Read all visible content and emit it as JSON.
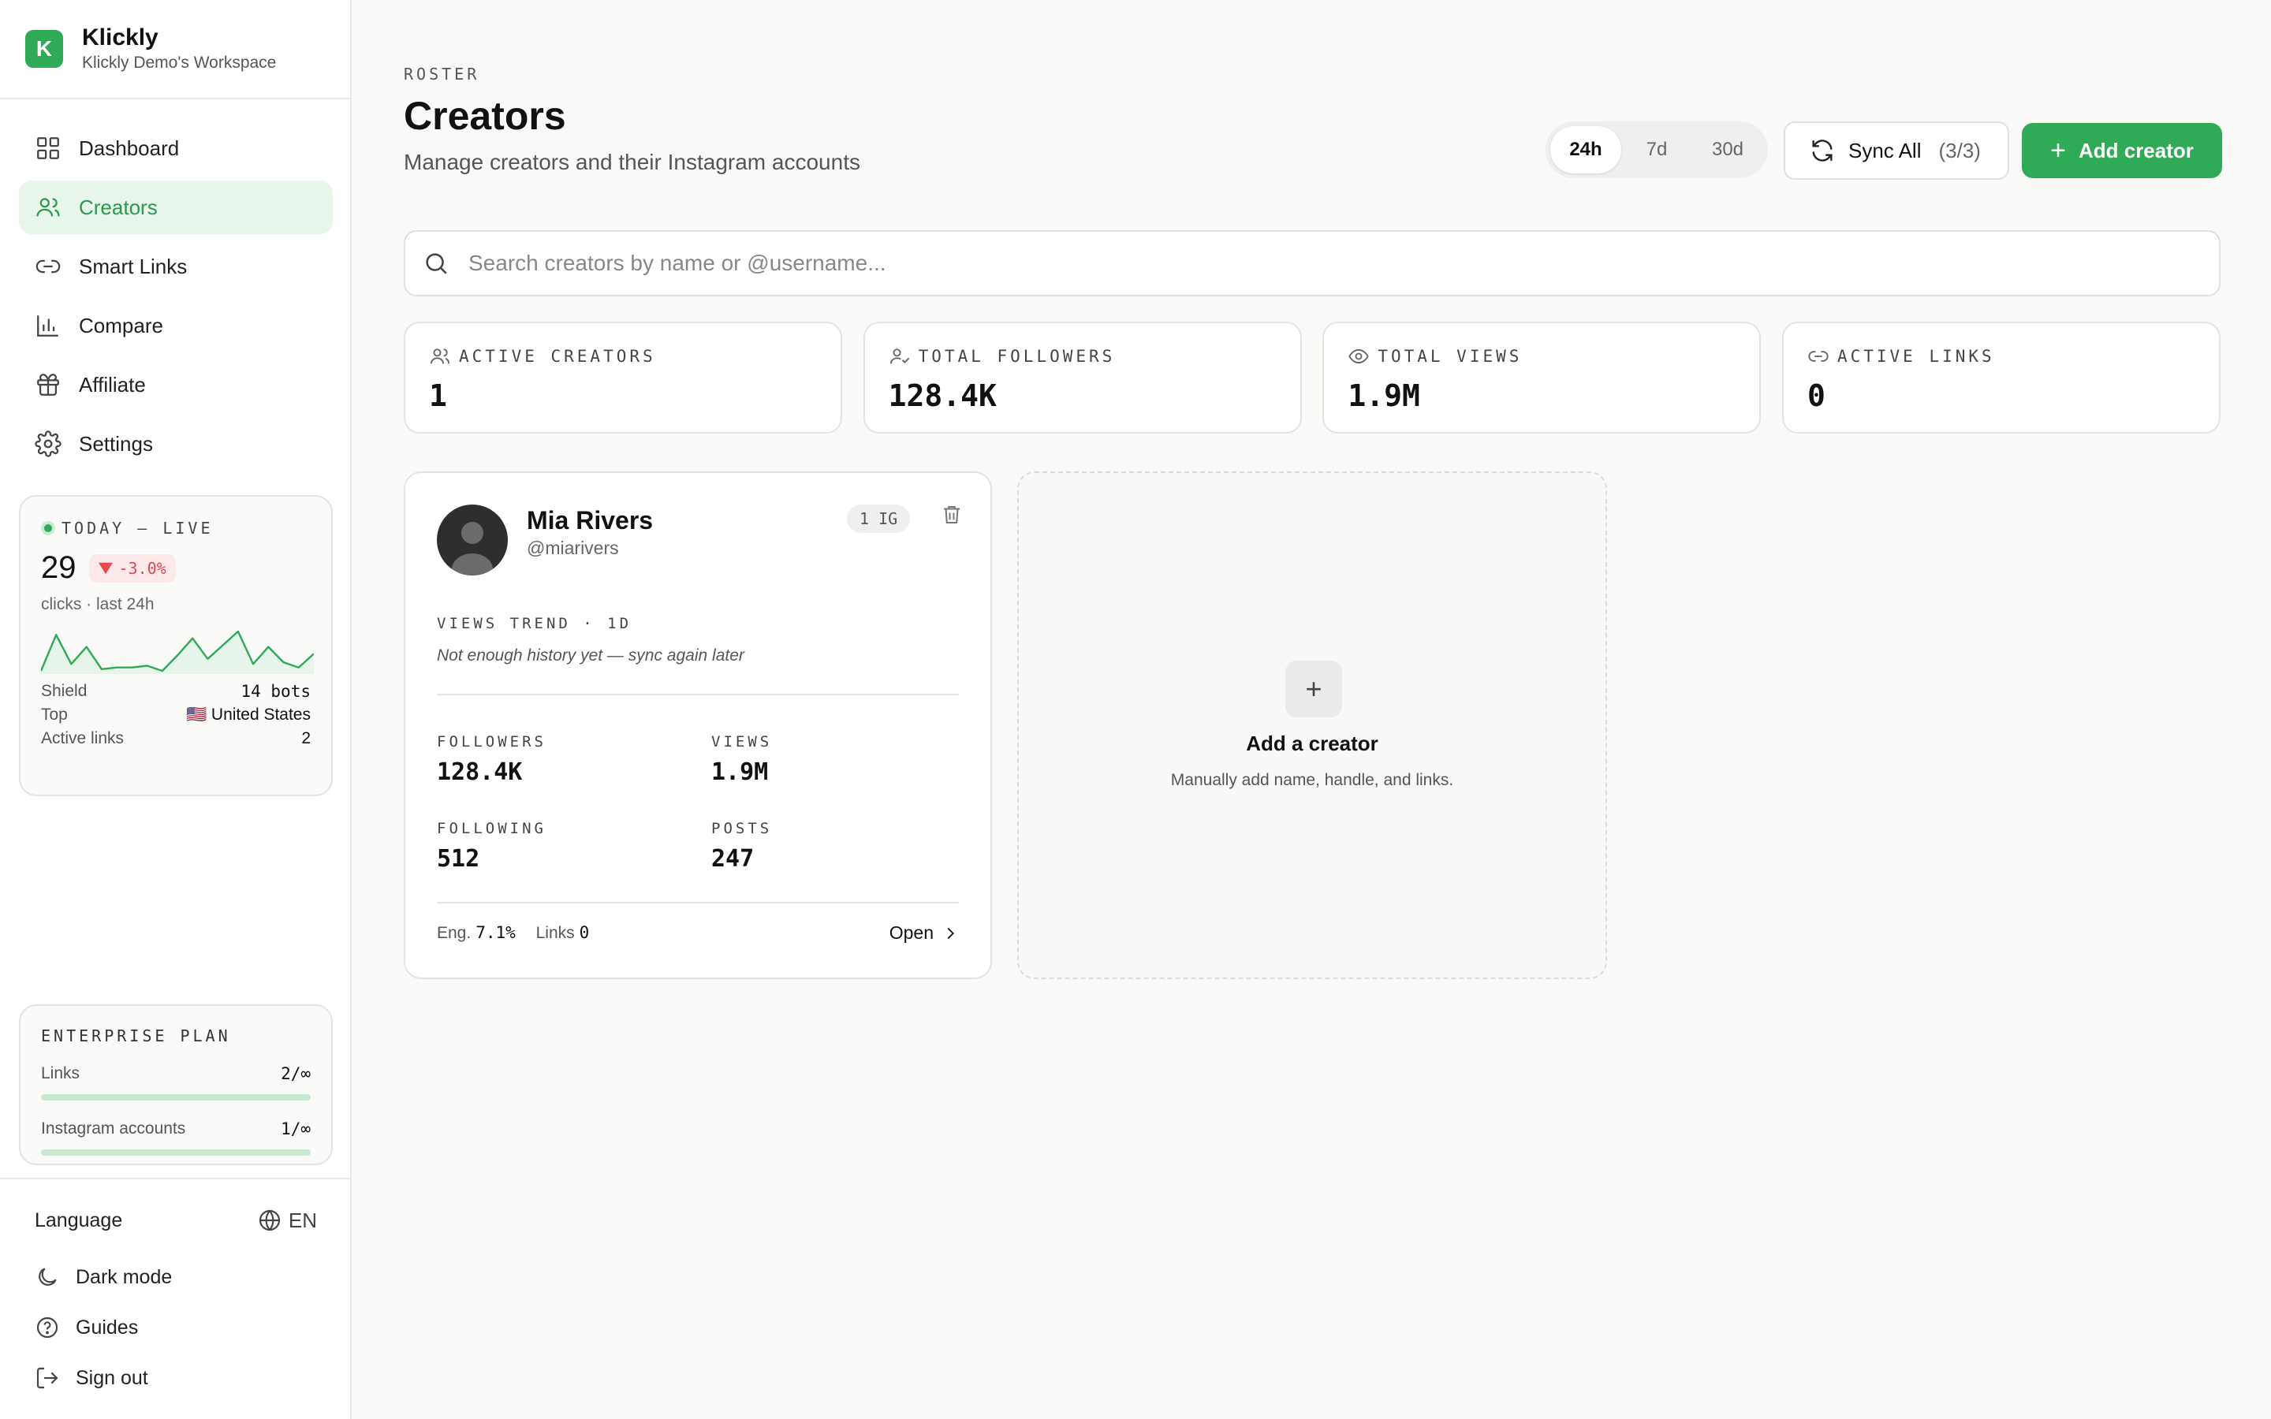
{
  "brand": {
    "logo_letter": "K",
    "name": "Klickly",
    "workspace": "Klickly Demo's Workspace"
  },
  "nav": [
    {
      "label": "Dashboard",
      "icon": "dashboard-icon",
      "active": false
    },
    {
      "label": "Creators",
      "icon": "users-icon",
      "active": true
    },
    {
      "label": "Smart Links",
      "icon": "link-icon",
      "active": false
    },
    {
      "label": "Compare",
      "icon": "bar-chart-icon",
      "active": false
    },
    {
      "label": "Affiliate",
      "icon": "gift-icon",
      "active": false
    },
    {
      "label": "Settings",
      "icon": "gear-icon",
      "active": false
    }
  ],
  "live": {
    "title": "TODAY — LIVE",
    "clicks": "29",
    "change": "-3.0%",
    "sub": "clicks · last 24h",
    "sparkline": [
      0,
      42,
      8,
      28,
      2,
      4,
      4,
      6,
      0,
      18,
      38,
      14,
      30,
      46,
      8,
      28,
      10,
      4,
      20
    ],
    "shield_label": "Shield",
    "shield_value": "14 bots",
    "top_label": "Top",
    "top_value": "🇺🇸 United States",
    "links_label": "Active links",
    "links_value": "2"
  },
  "plan": {
    "title": "ENTERPRISE PLAN",
    "links_label": "Links",
    "links_value": "2/∞",
    "ig_label": "Instagram accounts",
    "ig_value": "1/∞"
  },
  "bottom": {
    "language_label": "Language",
    "language_value": "EN",
    "dark_mode": "Dark mode",
    "guides": "Guides",
    "sign_out": "Sign out"
  },
  "header": {
    "eyebrow": "ROSTER",
    "title": "Creators",
    "subtitle": "Manage creators and their Instagram accounts",
    "ranges": [
      "24h",
      "7d",
      "30d"
    ],
    "active_range": "24h",
    "sync_label": "Sync All",
    "sync_count": "(3/3)",
    "add_label": "Add creator"
  },
  "search": {
    "placeholder": "Search creators by name or @username..."
  },
  "stats": [
    {
      "label": "ACTIVE CREATORS",
      "value": "1",
      "icon": "users-icon"
    },
    {
      "label": "TOTAL FOLLOWERS",
      "value": "128.4K",
      "icon": "user-check-icon"
    },
    {
      "label": "TOTAL VIEWS",
      "value": "1.9M",
      "icon": "eye-icon"
    },
    {
      "label": "ACTIVE LINKS",
      "value": "0",
      "icon": "link-icon"
    }
  ],
  "creator": {
    "name": "Mia Rivers",
    "handle": "@miarivers",
    "badge": "1 IG",
    "trend_label": "VIEWS TREND · 1D",
    "trend_note": "Not enough history yet — sync again later",
    "followers_label": "FOLLOWERS",
    "followers": "128.4K",
    "views_label": "VIEWS",
    "views": "1.9M",
    "following_label": "FOLLOWING",
    "following": "512",
    "posts_label": "POSTS",
    "posts": "247",
    "eng_label": "Eng.",
    "eng": "7.1%",
    "links_label": "Links",
    "links": "0",
    "open_label": "Open"
  },
  "add_card": {
    "plus": "+",
    "title": "Add a creator",
    "subtitle": "Manually add name, handle, and links."
  },
  "colors": {
    "accent": "#2faa57",
    "accent_soft": "#e8f5ea",
    "negative": "#e5484d"
  }
}
